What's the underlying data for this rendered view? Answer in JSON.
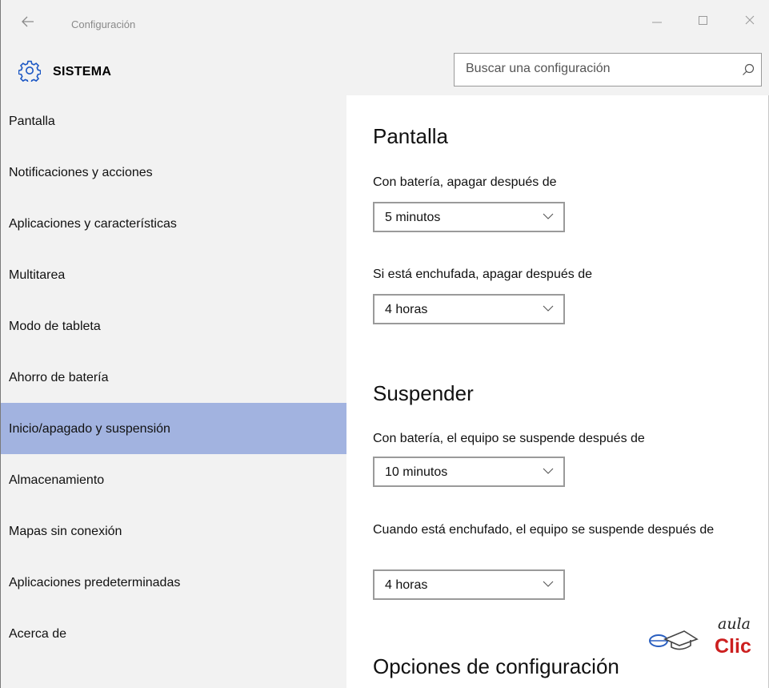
{
  "window": {
    "title": "Configuración",
    "back_icon": "arrow-left-icon",
    "minimize_icon": "minimize-icon",
    "maximize_icon": "maximize-icon",
    "close_icon": "close-icon"
  },
  "header": {
    "icon": "gear-icon",
    "section_title": "SISTEMA",
    "search_placeholder": "Buscar una configuración",
    "search_icon": "search-icon"
  },
  "sidebar": {
    "active_color": "#a2b3e0",
    "items": [
      {
        "label": "Pantalla",
        "active": false
      },
      {
        "label": "Notificaciones y acciones",
        "active": false
      },
      {
        "label": "Aplicaciones y características",
        "active": false
      },
      {
        "label": "Multitarea",
        "active": false
      },
      {
        "label": "Modo de tableta",
        "active": false
      },
      {
        "label": "Ahorro de batería",
        "active": false
      },
      {
        "label": "Inicio/apagado y suspensión",
        "active": true
      },
      {
        "label": "Almacenamiento",
        "active": false
      },
      {
        "label": "Mapas sin conexión",
        "active": false
      },
      {
        "label": "Aplicaciones predeterminadas",
        "active": false
      },
      {
        "label": "Acerca de",
        "active": false
      }
    ]
  },
  "main": {
    "screen_section": {
      "title": "Pantalla",
      "battery_label": "Con batería, apagar después de",
      "battery_value": "5 minutos",
      "plugged_label": "Si está enchufada, apagar después de",
      "plugged_value": "4 horas"
    },
    "sleep_section": {
      "title": "Suspender",
      "battery_label": "Con batería, el equipo se suspende después de",
      "battery_value": "10 minutos",
      "plugged_label": "Cuando está enchufado, el equipo se suspende después de",
      "plugged_value": "4 horas"
    },
    "options_section": {
      "title": "Opciones de configuración"
    }
  },
  "watermark": {
    "line1": "aula",
    "line2": "Clic",
    "accent_color": "#cc1f1f",
    "icon": "mouse-graduation-cap-icon"
  }
}
